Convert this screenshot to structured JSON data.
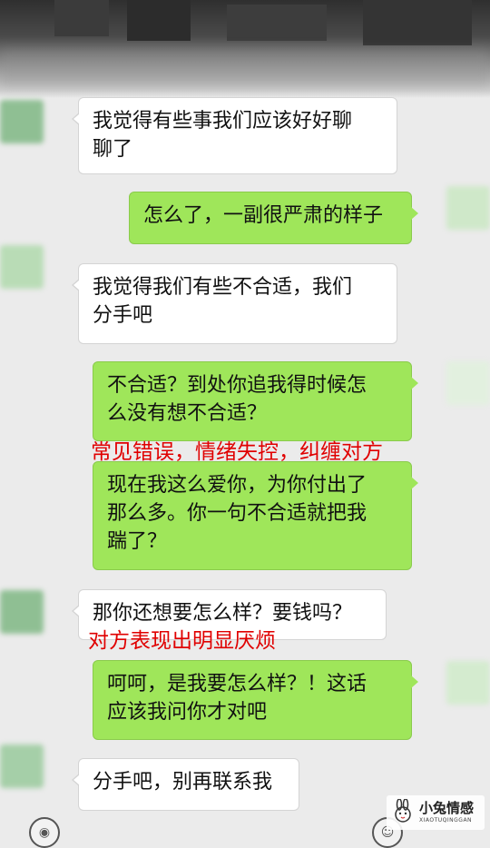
{
  "messages": [
    {
      "side": "in",
      "text": "我觉得有些事我们应该好好聊\n聊了"
    },
    {
      "side": "out",
      "text": "怎么了，一副很严肃的样子"
    },
    {
      "side": "in",
      "text": "我觉得我们有些不合适，我们\n分手吧"
    },
    {
      "side": "out",
      "text": "不合适？到处你追我得时候怎\n么没有想不合适？"
    },
    {
      "side": "out",
      "text": "现在我这么爱你，为你付出了\n那么多。你一句不合适就把我\n踹了？"
    },
    {
      "side": "in",
      "text": "那你还想要怎么样？要钱吗？"
    },
    {
      "side": "out",
      "text": "呵呵，是我要怎么样？！这话\n应该我问你才对吧"
    },
    {
      "side": "in",
      "text": "分手吧，别再联系我"
    }
  ],
  "annotations": [
    "常见错误，情绪失控，纠缠对方",
    "对方表现出明显厌烦"
  ],
  "watermark": {
    "title": "小兔情感",
    "subtitle": "XIAOTUQINGGAN"
  },
  "colors": {
    "incoming_bubble": "#ffffff",
    "outgoing_bubble": "#9fe65a",
    "annotation": "#e00000",
    "background": "#ebebeb"
  }
}
